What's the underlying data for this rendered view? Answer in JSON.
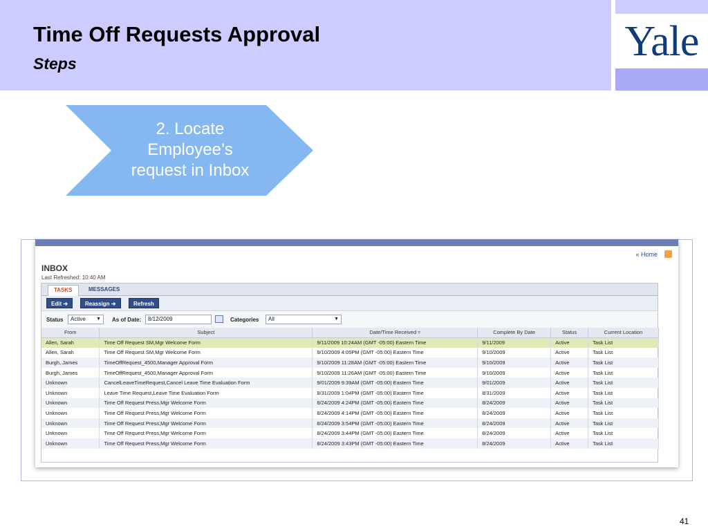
{
  "header": {
    "title": "Time Off Requests Approval",
    "subtitle": "Steps",
    "logo_text": "Yale"
  },
  "step": {
    "line1": "2. Locate",
    "line2": "Employee’s",
    "line3": "request in Inbox"
  },
  "screenshot": {
    "home_link": "« Home",
    "inbox_title": "INBOX",
    "last_refreshed": "Last Refreshed: 10:40 AM",
    "tabs": [
      "TASKS",
      "MESSAGES"
    ],
    "buttons": {
      "edit": "Edit ➔",
      "reassign": "Reassign ➔",
      "refresh": "Refresh"
    },
    "filters": {
      "status_label": "Status",
      "status_value": "Active",
      "as_of_label": "As of Date:",
      "as_of_value": "8/12/2009",
      "categories_label": "Categories",
      "categories_value": "All"
    },
    "columns": [
      "From",
      "Subject",
      "Date/Time Received",
      "Complete By Date",
      "Status",
      "Current Location"
    ],
    "rows": [
      [
        "Allen, Sarah",
        "Time Off Request SM,Mgr Welcome Form",
        "9/11/2009 10:24AM (GMT -05:00) Eastern Time",
        "9/11/2009",
        "Active",
        "Task List"
      ],
      [
        "Allen, Sarah",
        "Time Off Request SM,Mgr Welcome Form",
        "9/10/2009 4:05PM (GMT -05:00) Eastern Time",
        "9/10/2009",
        "Active",
        "Task List"
      ],
      [
        "Burgh, James",
        "TimeOffRequest_4500,Manager Approval Form",
        "9/10/2009 11:28AM (GMT -05:00) Eastern Time",
        "9/10/2009",
        "Active",
        "Task List"
      ],
      [
        "Burgh, James",
        "TimeOffRequest_4500,Manager Approval Form",
        "9/10/2009 11:26AM (GMT -05:00) Eastern Time",
        "9/10/2009",
        "Active",
        "Task List"
      ],
      [
        "Unknown",
        "CancelLeaveTimeRequest,Cancel Leave Time Evaluation Form",
        "9/01/2009 9:39AM (GMT -05:00) Eastern Time",
        "9/01/2009",
        "Active",
        "Task List"
      ],
      [
        "Unknown",
        "Leave Time Request,Leave Time Evaluation Form",
        "8/31/2009 1:04PM (GMT -05:00) Eastern Time",
        "8/31/2009",
        "Active",
        "Task List"
      ],
      [
        "Unknown",
        "Time Off Request Press,Mgr Welcome Form",
        "8/24/2009 4:24PM (GMT -05:00) Eastern Time",
        "8/24/2009",
        "Active",
        "Task List"
      ],
      [
        "Unknown",
        "Time Off Request Press,Mgr Welcome Form",
        "8/24/2009 4:14PM (GMT -05:00) Eastern Time",
        "8/24/2009",
        "Active",
        "Task List"
      ],
      [
        "Unknown",
        "Time Off Request Press,Mgr Welcome Form",
        "8/24/2009 3:54PM (GMT -05:00) Eastern Time",
        "8/24/2009",
        "Active",
        "Task List"
      ],
      [
        "Unknown",
        "Time Off Request Press,Mgr Welcome Form",
        "8/24/2009 3:44PM (GMT -05:00) Eastern Time",
        "8/24/2009",
        "Active",
        "Task List"
      ],
      [
        "Unknown",
        "Time Off Request Press,Mgr Welcome Form",
        "8/24/2009 3:43PM (GMT -05:00) Eastern Time",
        "8/24/2009",
        "Active",
        "Task List"
      ]
    ]
  },
  "page_number": "41",
  "colors": {
    "header_band": "#ccccff",
    "chevron": "#85b8f0",
    "logo": "#0e3b7a"
  }
}
